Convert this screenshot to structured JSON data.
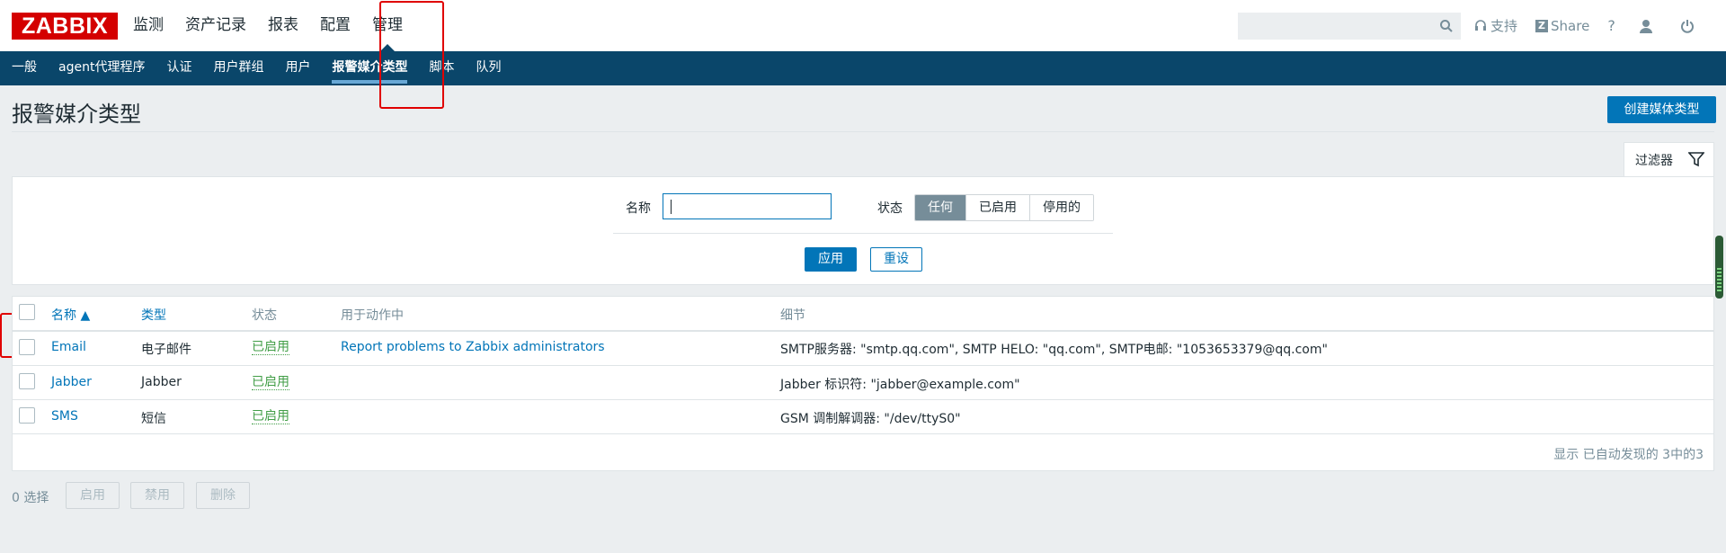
{
  "header": {
    "logo": "ZABBIX",
    "menu": [
      "监测",
      "资产记录",
      "报表",
      "配置",
      "管理"
    ],
    "links": {
      "support": "支持",
      "share": "Share",
      "help": "?"
    }
  },
  "subnav": [
    "一般",
    "agent代理程序",
    "认证",
    "用户群组",
    "用户",
    "报警媒介类型",
    "脚本",
    "队列"
  ],
  "page": {
    "title": "报警媒介类型",
    "create_button": "创建媒体类型"
  },
  "filter": {
    "tab_label": "过滤器",
    "name_label": "名称",
    "name_value": "",
    "status_label": "状态",
    "status_options": [
      "任何",
      "已启用",
      "停用的"
    ],
    "status_selected": "任何",
    "apply": "应用",
    "reset": "重设"
  },
  "table": {
    "columns": [
      "名称 ▲",
      "类型",
      "状态",
      "用于动作中",
      "细节"
    ],
    "rows": [
      {
        "name": "Email",
        "type": "电子邮件",
        "status": "已启用",
        "actions": "Report problems to Zabbix administrators",
        "details": "SMTP服务器: \"smtp.qq.com\", SMTP HELO: \"qq.com\", SMTP电邮: \"1053653379@qq.com\""
      },
      {
        "name": "Jabber",
        "type": "Jabber",
        "status": "已启用",
        "actions": "",
        "details": "Jabber 标识符: \"jabber@example.com\""
      },
      {
        "name": "SMS",
        "type": "短信",
        "status": "已启用",
        "actions": "",
        "details": "GSM 调制解调器: \"/dev/ttyS0\""
      }
    ],
    "footer": "显示 已自动发现的 3中的3"
  },
  "bulk": {
    "selected": "0 选择",
    "buttons": [
      "启用",
      "禁用",
      "删除"
    ]
  },
  "colors": {
    "brand": "#d40000",
    "nav": "#0a466a",
    "accent": "#0275b8",
    "enabled": "#429e47"
  }
}
